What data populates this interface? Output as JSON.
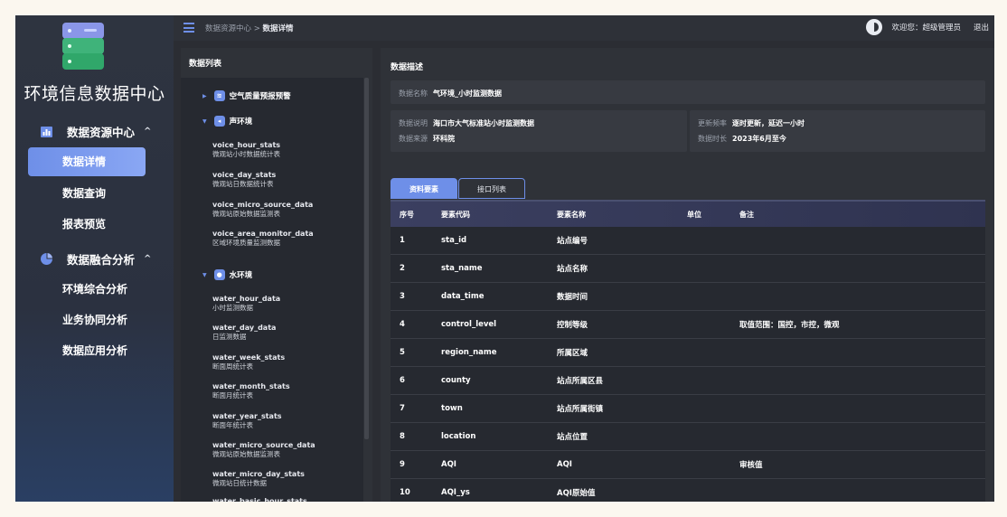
{
  "sidebar": {
    "brand": "环境信息数据中心",
    "groups": [
      {
        "label": "数据资源中心",
        "chevron": "^",
        "items": [
          "数据详情",
          "数据查询",
          "报表预览"
        ]
      },
      {
        "label": "数据融合分析",
        "chevron": "^",
        "items": [
          "环境综合分析",
          "业务协同分析",
          "数据应用分析"
        ]
      }
    ],
    "active_item": "数据详情"
  },
  "topbar": {
    "breadcrumb_parent": "数据资源中心",
    "breadcrumb_sep": ">",
    "breadcrumb_current": "数据详情",
    "welcome": "欢迎您：超级管理员",
    "logout": "退出"
  },
  "list_panel": {
    "title": "数据列表",
    "groups": [
      {
        "label": "空气质量预报预警",
        "expanded": false
      },
      {
        "label": "声环境",
        "expanded": true
      },
      {
        "label": "水环境",
        "expanded": true
      }
    ],
    "noise_items": [
      {
        "code": "voice_hour_stats",
        "desc": "微观站小时数据统计表"
      },
      {
        "code": "voice_day_stats",
        "desc": "微观站日数据统计表"
      },
      {
        "code": "voice_micro_source_data",
        "desc": "微观站原始数据监测表"
      },
      {
        "code": "voice_area_monitor_data",
        "desc": "区域环境质量监测数据"
      }
    ],
    "water_items": [
      {
        "code": "water_hour_data",
        "desc": "小时监测数据"
      },
      {
        "code": "water_day_data",
        "desc": "日监测数据"
      },
      {
        "code": "water_week_stats",
        "desc": "断面周统计表"
      },
      {
        "code": "water_month_stats",
        "desc": "断面月统计表"
      },
      {
        "code": "water_year_stats",
        "desc": "断面年统计表"
      },
      {
        "code": "water_micro_source_data",
        "desc": "微观站原始数据监测表"
      },
      {
        "code": "water_micro_day_stats",
        "desc": "微观站日统计数据"
      },
      {
        "code": "water_basic_hour_stats",
        "desc": ""
      }
    ]
  },
  "detail": {
    "title": "数据描述",
    "name_label": "数据名称",
    "name_value": "气环境_小时监测数据",
    "desc_label": "数据说明",
    "desc_value": "海口市大气标准站小时监测数据",
    "source_label": "数据来源",
    "source_value": "环科院",
    "freq_label": "更新频率",
    "freq_value": "逐时更新，延迟一小时",
    "duration_label": "数据时长",
    "duration_value": "2023年6月至今",
    "tabs": [
      "资料要素",
      "接口列表"
    ],
    "table": {
      "headers": [
        "序号",
        "要素代码",
        "要素名称",
        "单位",
        "备注"
      ],
      "rows": [
        [
          "1",
          "sta_id",
          "站点编号",
          "",
          ""
        ],
        [
          "2",
          "sta_name",
          "站点名称",
          "",
          ""
        ],
        [
          "3",
          "data_time",
          "数据时间",
          "",
          ""
        ],
        [
          "4",
          "control_level",
          "控制等级",
          "",
          "取值范围：国控，市控，微观"
        ],
        [
          "5",
          "region_name",
          "所属区域",
          "",
          ""
        ],
        [
          "6",
          "county",
          "站点所属区县",
          "",
          ""
        ],
        [
          "7",
          "town",
          "站点所属街镇",
          "",
          ""
        ],
        [
          "8",
          "location",
          "站点位置",
          "",
          ""
        ],
        [
          "9",
          "AQI",
          "AQI",
          "",
          "审核值"
        ],
        [
          "10",
          "AQI_ys",
          "AQI原始值",
          "",
          ""
        ]
      ]
    }
  },
  "colors": {
    "accent": "#6e8fe8",
    "background": "#2b2d33"
  }
}
